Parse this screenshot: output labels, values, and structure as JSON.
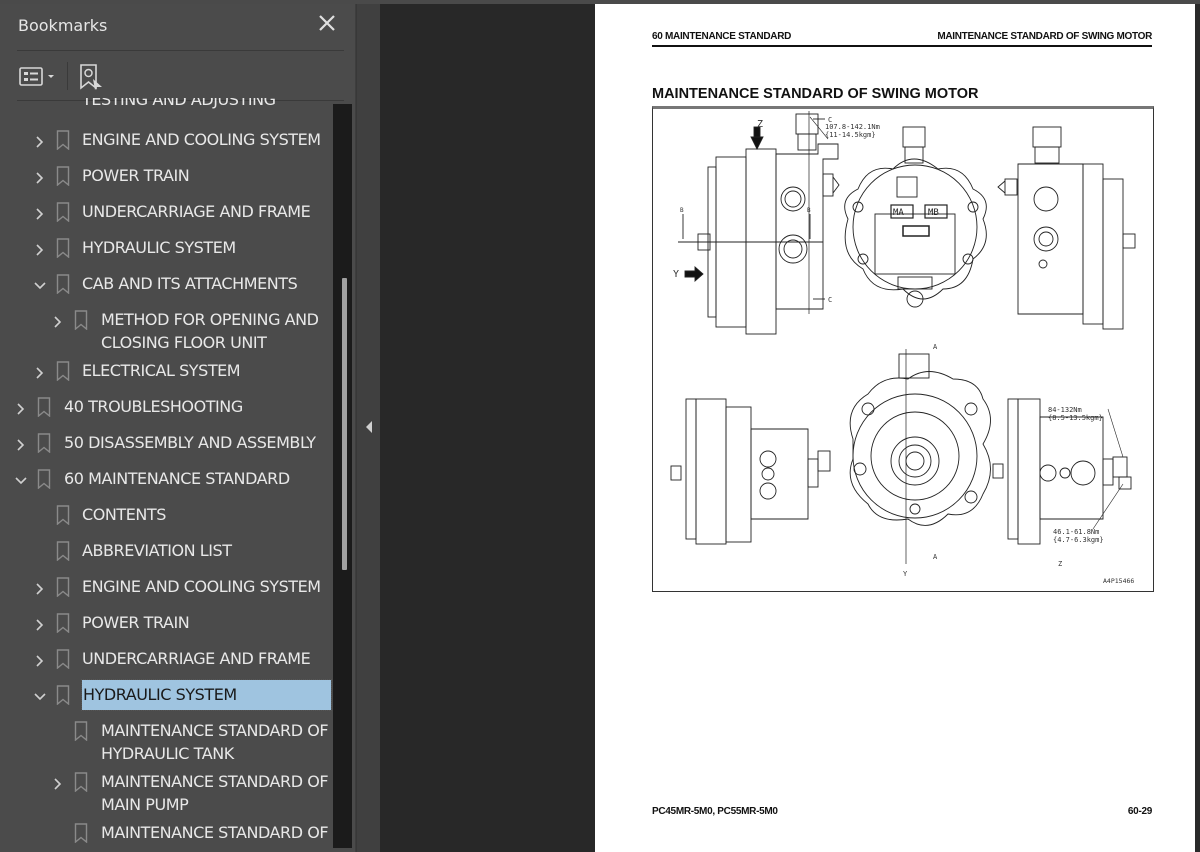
{
  "sidebar": {
    "title": "Bookmarks",
    "close_icon": "close-icon",
    "tools": {
      "options_icon": "list-options-icon",
      "find_bookmark_icon": "find-current-bookmark-icon"
    },
    "items": [
      {
        "label": "TESTING AND ADJUSTING",
        "level": 1,
        "expander": "none",
        "partial": true
      },
      {
        "label": "ENGINE AND COOLING SYSTEM",
        "level": 1,
        "expander": "collapsed"
      },
      {
        "label": "POWER TRAIN",
        "level": 1,
        "expander": "collapsed"
      },
      {
        "label": "UNDERCARRIAGE AND FRAME",
        "level": 1,
        "expander": "collapsed"
      },
      {
        "label": "HYDRAULIC SYSTEM",
        "level": 1,
        "expander": "collapsed"
      },
      {
        "label": "CAB AND ITS ATTACHMENTS",
        "level": 1,
        "expander": "expanded"
      },
      {
        "label": "METHOD FOR OPENING AND\nCLOSING FLOOR UNIT",
        "level": 2,
        "expander": "collapsed"
      },
      {
        "label": "ELECTRICAL SYSTEM",
        "level": 1,
        "expander": "collapsed"
      },
      {
        "label": "40 TROUBLESHOOTING",
        "level": 0,
        "expander": "collapsed"
      },
      {
        "label": "50 DISASSEMBLY AND ASSEMBLY",
        "level": 0,
        "expander": "collapsed"
      },
      {
        "label": "60 MAINTENANCE STANDARD",
        "level": 0,
        "expander": "expanded"
      },
      {
        "label": "CONTENTS",
        "level": 1,
        "expander": "none"
      },
      {
        "label": "ABBREVIATION LIST",
        "level": 1,
        "expander": "none"
      },
      {
        "label": "ENGINE AND COOLING SYSTEM",
        "level": 1,
        "expander": "collapsed"
      },
      {
        "label": "POWER TRAIN",
        "level": 1,
        "expander": "collapsed"
      },
      {
        "label": "UNDERCARRIAGE AND FRAME",
        "level": 1,
        "expander": "collapsed"
      },
      {
        "label": "HYDRAULIC SYSTEM",
        "level": 1,
        "expander": "expanded",
        "selected": true
      },
      {
        "label": "MAINTENANCE STANDARD OF\nHYDRAULIC TANK",
        "level": 2,
        "expander": "none"
      },
      {
        "label": "MAINTENANCE STANDARD OF\nMAIN PUMP",
        "level": 2,
        "expander": "collapsed"
      },
      {
        "label": "MAINTENANCE STANDARD OF",
        "level": 2,
        "expander": "none",
        "partial": true
      }
    ],
    "selection_color": "#9fc4e0"
  },
  "splitter": {
    "collapse_icon": "collapse-panel-left-icon"
  },
  "document": {
    "header_left": "60 MAINTENANCE STANDARD",
    "header_right": "MAINTENANCE STANDARD OF SWING MOTOR",
    "title": "MAINTENANCE STANDARD OF SWING MOTOR",
    "figure": {
      "torque_top_1": "107.8-142.1Nm",
      "torque_top_2": "{11-14.5kgm}",
      "torque_br_1a": "84-132Nm",
      "torque_br_1b": "{8.5-13.5kgm}",
      "torque_br_2a": "46.1-61.8Nm",
      "torque_br_2b": "{4.7-6.3kgm}",
      "label_z": "Z",
      "label_y": "Y",
      "label_a": "A",
      "label_b": "B",
      "label_c": "C",
      "port_ma": "MA",
      "port_mb": "MB",
      "figure_id": "A4P15466"
    },
    "footer_left": "PC45MR-5M0, PC55MR-5M0",
    "footer_right": "60-29"
  }
}
